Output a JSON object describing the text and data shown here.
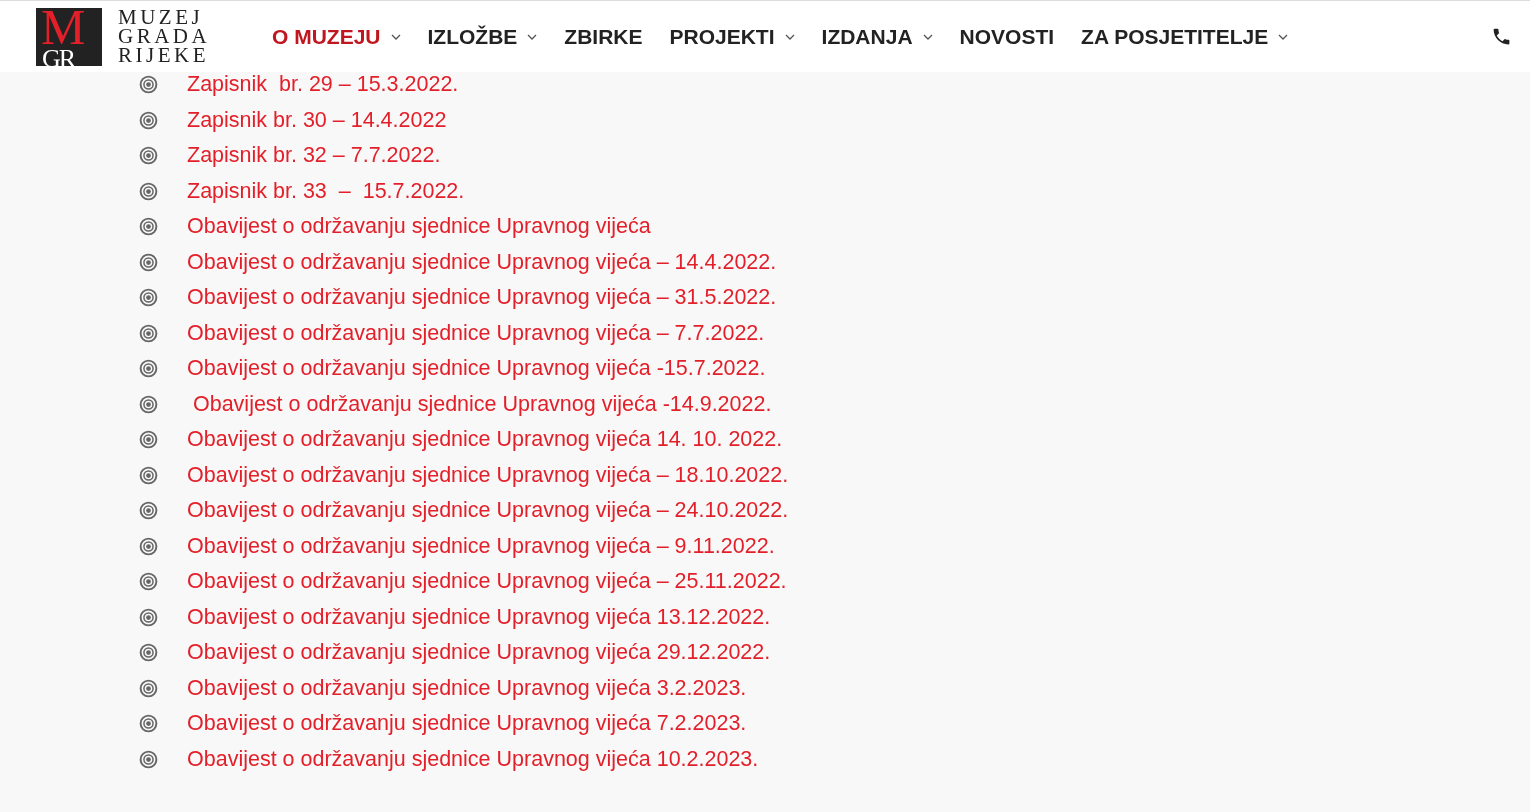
{
  "header": {
    "logo": {
      "mark_top": "M",
      "mark_bottom": "GR",
      "lines": [
        "MUZEJ",
        "GRADA",
        "RIJEKE"
      ]
    },
    "nav": [
      {
        "label": "O MUZEJU",
        "selected": true,
        "has_menu": true
      },
      {
        "label": "IZLOŽBE",
        "selected": false,
        "has_menu": true
      },
      {
        "label": "ZBIRKE",
        "selected": false,
        "has_menu": false
      },
      {
        "label": "PROJEKTI",
        "selected": false,
        "has_menu": true
      },
      {
        "label": "IZDANJA",
        "selected": false,
        "has_menu": true
      },
      {
        "label": "NOVOSTI",
        "selected": false,
        "has_menu": false
      },
      {
        "label": "ZA POSJETITELJE",
        "selected": false,
        "has_menu": true
      }
    ]
  },
  "links": [
    "Zapisnik  br. 29 – 15.3.2022.",
    "Zapisnik br. 30 – 14.4.2022",
    "Zapisnik br. 32 – 7.7.2022.",
    "Zapisnik br. 33  –  15.7.2022.",
    "Obavijest o održavanju sjednice Upravnog vijeća",
    "Obavijest o održavanju sjednice Upravnog vijeća – 14.4.2022.",
    "Obavijest o održavanju sjednice Upravnog vijeća – 31.5.2022.",
    "Obavijest o održavanju sjednice Upravnog vijeća – 7.7.2022.",
    "Obavijest o održavanju sjednice Upravnog vijeća -15.7.2022.",
    " Obavijest o održavanju sjednice Upravnog vijeća -14.9.2022.",
    "Obavijest o održavanju sjednice Upravnog vijeća 14. 10. 2022.",
    "Obavijest o održavanju sjednice Upravnog vijeća – 18.10.2022.",
    "Obavijest o održavanju sjednice Upravnog vijeća – 24.10.2022.",
    "Obavijest o održavanju sjednice Upravnog vijeća – 9.11.2022.",
    "Obavijest o održavanju sjednice Upravnog vijeća – 25.11.2022.",
    "Obavijest o održavanju sjednice Upravnog vijeća 13.12.2022.",
    "Obavijest o održavanju sjednice Upravnog vijeća 29.12.2022.",
    "Obavijest o održavanju sjednice Upravnog vijeća 3.2.2023.",
    "Obavijest o održavanju sjednice Upravnog vijeća 7.2.2023.",
    "Obavijest o održavanju sjednice Upravnog vijeća 10.2.2023."
  ]
}
